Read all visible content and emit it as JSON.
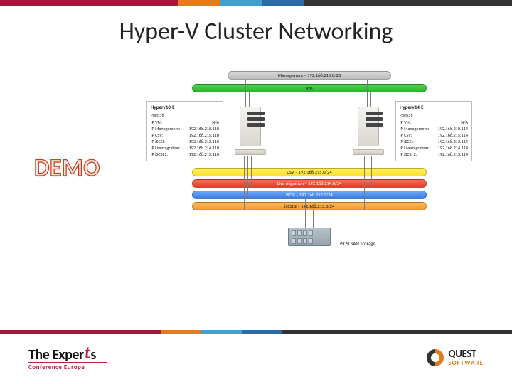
{
  "title": "Hyper-V Cluster Networking",
  "demo_label": "DEMO",
  "networks": {
    "management": "Management – 192.168.210.0/23",
    "vm": "VM",
    "csv": "CSV – 192.168.215.0/24",
    "livemigration": "Live migration – 192.168.214.0/24",
    "iscsi1": "iSCSI – 192.168.212.0/24",
    "iscsi2": "iSCSI 2 – 192.168.213.0/24"
  },
  "hosts": {
    "left": {
      "name": "Hyperv10-E",
      "ports_label": "Ports: 6",
      "rows": [
        {
          "k": "IP VM:",
          "v": "N/A"
        },
        {
          "k": "IP Management:",
          "v": "192.168.210.110"
        },
        {
          "k": "IP CSV:",
          "v": "192.168.215.110"
        },
        {
          "k": "IP iSCSI:",
          "v": "192.168.212.110"
        },
        {
          "k": "IP Livemigration:",
          "v": "192.168.214.110"
        },
        {
          "k": "IP iSCSI 2:",
          "v": "192.168.213.110"
        }
      ]
    },
    "right": {
      "name": "Hyperv14-E",
      "ports_label": "Ports: 6",
      "rows": [
        {
          "k": "IP VM:",
          "v": "N/A"
        },
        {
          "k": "IP Management:",
          "v": "192.168.210.114"
        },
        {
          "k": "IP CSV:",
          "v": "192.168.215.114"
        },
        {
          "k": "IP iSCSI:",
          "v": "192.168.212.114"
        },
        {
          "k": "IP Livemigration:",
          "v": "192.168.214.114"
        },
        {
          "k": "IP iSCSI 2:",
          "v": "192.168.213.114"
        }
      ]
    }
  },
  "storage_label": "iSCSI SAN Storage",
  "logos": {
    "experts_line1a": "The Exper",
    "experts_line1b": "t",
    "experts_line1c": "s",
    "experts_line2": "Conference Europe",
    "quest_line1": "QUEST",
    "quest_line2": "SOFTWARE"
  }
}
